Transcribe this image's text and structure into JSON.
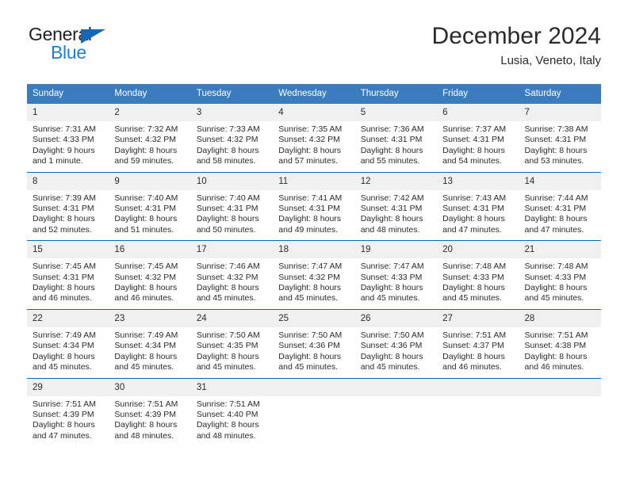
{
  "brand": {
    "name_top": "General",
    "name_bottom": "Blue",
    "triangle_icon": "brand-triangle-icon",
    "color_dark": "#231f20",
    "color_blue": "#1f7fd4"
  },
  "header": {
    "title": "December 2024",
    "subtitle": "Lusia, Veneto, Italy"
  },
  "theme": {
    "header_blue": "#3a7cbe",
    "rule_blue": "#1667b3",
    "daynum_gray": "#f0f0f0",
    "text": "#2b2b2b"
  },
  "calendar": {
    "weekday_headers": [
      "Sunday",
      "Monday",
      "Tuesday",
      "Wednesday",
      "Thursday",
      "Friday",
      "Saturday"
    ],
    "labels": {
      "sunrise_prefix": "Sunrise:",
      "sunset_prefix": "Sunset:",
      "daylight_prefix": "Daylight:"
    },
    "weeks": [
      [
        {
          "day": "1",
          "sunrise": "Sunrise: 7:31 AM",
          "sunset": "Sunset: 4:33 PM",
          "daylight_line1": "Daylight: 9 hours",
          "daylight_line2": "and 1 minute."
        },
        {
          "day": "2",
          "sunrise": "Sunrise: 7:32 AM",
          "sunset": "Sunset: 4:32 PM",
          "daylight_line1": "Daylight: 8 hours",
          "daylight_line2": "and 59 minutes."
        },
        {
          "day": "3",
          "sunrise": "Sunrise: 7:33 AM",
          "sunset": "Sunset: 4:32 PM",
          "daylight_line1": "Daylight: 8 hours",
          "daylight_line2": "and 58 minutes."
        },
        {
          "day": "4",
          "sunrise": "Sunrise: 7:35 AM",
          "sunset": "Sunset: 4:32 PM",
          "daylight_line1": "Daylight: 8 hours",
          "daylight_line2": "and 57 minutes."
        },
        {
          "day": "5",
          "sunrise": "Sunrise: 7:36 AM",
          "sunset": "Sunset: 4:31 PM",
          "daylight_line1": "Daylight: 8 hours",
          "daylight_line2": "and 55 minutes."
        },
        {
          "day": "6",
          "sunrise": "Sunrise: 7:37 AM",
          "sunset": "Sunset: 4:31 PM",
          "daylight_line1": "Daylight: 8 hours",
          "daylight_line2": "and 54 minutes."
        },
        {
          "day": "7",
          "sunrise": "Sunrise: 7:38 AM",
          "sunset": "Sunset: 4:31 PM",
          "daylight_line1": "Daylight: 8 hours",
          "daylight_line2": "and 53 minutes."
        }
      ],
      [
        {
          "day": "8",
          "sunrise": "Sunrise: 7:39 AM",
          "sunset": "Sunset: 4:31 PM",
          "daylight_line1": "Daylight: 8 hours",
          "daylight_line2": "and 52 minutes."
        },
        {
          "day": "9",
          "sunrise": "Sunrise: 7:40 AM",
          "sunset": "Sunset: 4:31 PM",
          "daylight_line1": "Daylight: 8 hours",
          "daylight_line2": "and 51 minutes."
        },
        {
          "day": "10",
          "sunrise": "Sunrise: 7:40 AM",
          "sunset": "Sunset: 4:31 PM",
          "daylight_line1": "Daylight: 8 hours",
          "daylight_line2": "and 50 minutes."
        },
        {
          "day": "11",
          "sunrise": "Sunrise: 7:41 AM",
          "sunset": "Sunset: 4:31 PM",
          "daylight_line1": "Daylight: 8 hours",
          "daylight_line2": "and 49 minutes."
        },
        {
          "day": "12",
          "sunrise": "Sunrise: 7:42 AM",
          "sunset": "Sunset: 4:31 PM",
          "daylight_line1": "Daylight: 8 hours",
          "daylight_line2": "and 48 minutes."
        },
        {
          "day": "13",
          "sunrise": "Sunrise: 7:43 AM",
          "sunset": "Sunset: 4:31 PM",
          "daylight_line1": "Daylight: 8 hours",
          "daylight_line2": "and 47 minutes."
        },
        {
          "day": "14",
          "sunrise": "Sunrise: 7:44 AM",
          "sunset": "Sunset: 4:31 PM",
          "daylight_line1": "Daylight: 8 hours",
          "daylight_line2": "and 47 minutes."
        }
      ],
      [
        {
          "day": "15",
          "sunrise": "Sunrise: 7:45 AM",
          "sunset": "Sunset: 4:31 PM",
          "daylight_line1": "Daylight: 8 hours",
          "daylight_line2": "and 46 minutes."
        },
        {
          "day": "16",
          "sunrise": "Sunrise: 7:45 AM",
          "sunset": "Sunset: 4:32 PM",
          "daylight_line1": "Daylight: 8 hours",
          "daylight_line2": "and 46 minutes."
        },
        {
          "day": "17",
          "sunrise": "Sunrise: 7:46 AM",
          "sunset": "Sunset: 4:32 PM",
          "daylight_line1": "Daylight: 8 hours",
          "daylight_line2": "and 45 minutes."
        },
        {
          "day": "18",
          "sunrise": "Sunrise: 7:47 AM",
          "sunset": "Sunset: 4:32 PM",
          "daylight_line1": "Daylight: 8 hours",
          "daylight_line2": "and 45 minutes."
        },
        {
          "day": "19",
          "sunrise": "Sunrise: 7:47 AM",
          "sunset": "Sunset: 4:33 PM",
          "daylight_line1": "Daylight: 8 hours",
          "daylight_line2": "and 45 minutes."
        },
        {
          "day": "20",
          "sunrise": "Sunrise: 7:48 AM",
          "sunset": "Sunset: 4:33 PM",
          "daylight_line1": "Daylight: 8 hours",
          "daylight_line2": "and 45 minutes."
        },
        {
          "day": "21",
          "sunrise": "Sunrise: 7:48 AM",
          "sunset": "Sunset: 4:33 PM",
          "daylight_line1": "Daylight: 8 hours",
          "daylight_line2": "and 45 minutes."
        }
      ],
      [
        {
          "day": "22",
          "sunrise": "Sunrise: 7:49 AM",
          "sunset": "Sunset: 4:34 PM",
          "daylight_line1": "Daylight: 8 hours",
          "daylight_line2": "and 45 minutes."
        },
        {
          "day": "23",
          "sunrise": "Sunrise: 7:49 AM",
          "sunset": "Sunset: 4:34 PM",
          "daylight_line1": "Daylight: 8 hours",
          "daylight_line2": "and 45 minutes."
        },
        {
          "day": "24",
          "sunrise": "Sunrise: 7:50 AM",
          "sunset": "Sunset: 4:35 PM",
          "daylight_line1": "Daylight: 8 hours",
          "daylight_line2": "and 45 minutes."
        },
        {
          "day": "25",
          "sunrise": "Sunrise: 7:50 AM",
          "sunset": "Sunset: 4:36 PM",
          "daylight_line1": "Daylight: 8 hours",
          "daylight_line2": "and 45 minutes."
        },
        {
          "day": "26",
          "sunrise": "Sunrise: 7:50 AM",
          "sunset": "Sunset: 4:36 PM",
          "daylight_line1": "Daylight: 8 hours",
          "daylight_line2": "and 45 minutes."
        },
        {
          "day": "27",
          "sunrise": "Sunrise: 7:51 AM",
          "sunset": "Sunset: 4:37 PM",
          "daylight_line1": "Daylight: 8 hours",
          "daylight_line2": "and 46 minutes."
        },
        {
          "day": "28",
          "sunrise": "Sunrise: 7:51 AM",
          "sunset": "Sunset: 4:38 PM",
          "daylight_line1": "Daylight: 8 hours",
          "daylight_line2": "and 46 minutes."
        }
      ],
      [
        {
          "day": "29",
          "sunrise": "Sunrise: 7:51 AM",
          "sunset": "Sunset: 4:39 PM",
          "daylight_line1": "Daylight: 8 hours",
          "daylight_line2": "and 47 minutes."
        },
        {
          "day": "30",
          "sunrise": "Sunrise: 7:51 AM",
          "sunset": "Sunset: 4:39 PM",
          "daylight_line1": "Daylight: 8 hours",
          "daylight_line2": "and 48 minutes."
        },
        {
          "day": "31",
          "sunrise": "Sunrise: 7:51 AM",
          "sunset": "Sunset: 4:40 PM",
          "daylight_line1": "Daylight: 8 hours",
          "daylight_line2": "and 48 minutes."
        },
        {
          "day": "",
          "sunrise": "",
          "sunset": "",
          "daylight_line1": "",
          "daylight_line2": ""
        },
        {
          "day": "",
          "sunrise": "",
          "sunset": "",
          "daylight_line1": "",
          "daylight_line2": ""
        },
        {
          "day": "",
          "sunrise": "",
          "sunset": "",
          "daylight_line1": "",
          "daylight_line2": ""
        },
        {
          "day": "",
          "sunrise": "",
          "sunset": "",
          "daylight_line1": "",
          "daylight_line2": ""
        }
      ]
    ]
  }
}
